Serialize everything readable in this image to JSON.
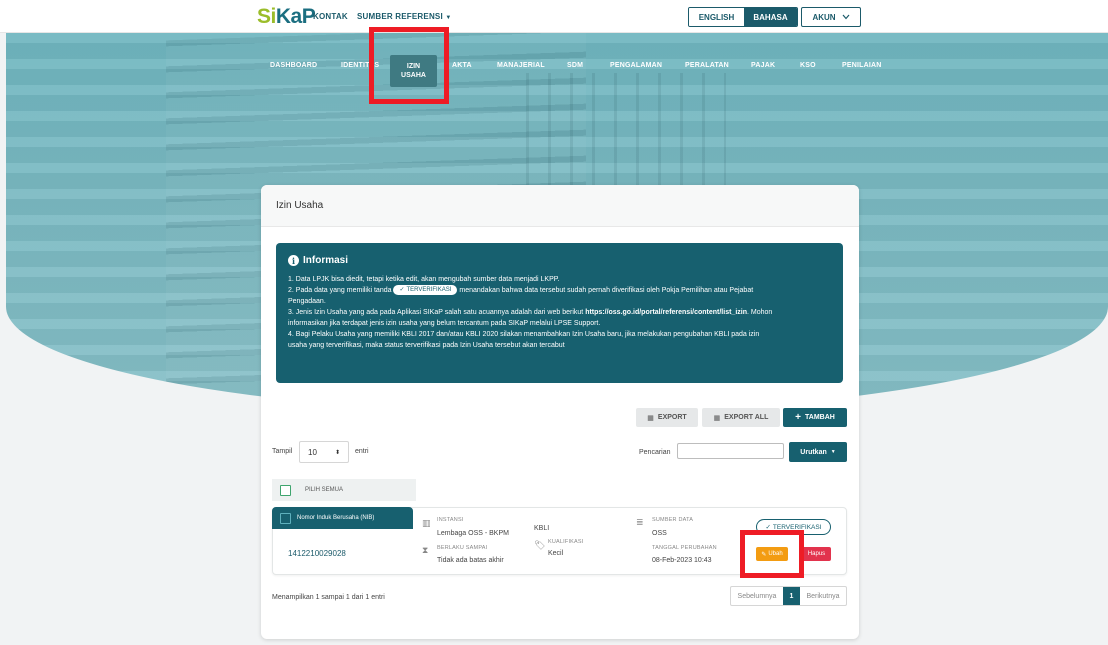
{
  "topbar": {
    "logo_part1": "Si",
    "logo_part2": "KaP",
    "links": [
      "KONTAK",
      "SUMBER REFERENSI"
    ],
    "dropdown_caret": "▼",
    "lang_en": "ENGLISH",
    "lang_id": "BAHASA",
    "akun": "AKUN"
  },
  "nav": {
    "items": [
      "DASHBOARD",
      "IDENTITAS",
      "AKTA",
      "MANAJERIAL",
      "SDM",
      "PENGALAMAN",
      "PERALATAN",
      "PAJAK",
      "KSO",
      "PENILAIAN"
    ],
    "active_line1": "IZIN",
    "active_line2": "USAHA"
  },
  "card": {
    "title": "Izin Usaha"
  },
  "info": {
    "title": "Informasi",
    "lines": [
      "1. Data LPJK bisa diedit, tetapi ketika edit, akan mengubah sumber data menjadi LKPP.",
      "2. Pada data yang memiliki tanda",
      "menandakan bahwa data tersebut sudah pernah diverifikasi oleh Pokja Pemilihan atau Pejabat",
      "Pengadaan.",
      "3. Jenis Izin Usaha yang ada pada Aplikasi SIKaP salah satu acuannya adalah dari web berikut",
      "https://oss.go.id/portal/referensi/content/list_izin",
      ". Mohon",
      "informasikan jika terdapat jenis izin usaha yang belum tercantum pada SIKaP melalui LPSE Support.",
      "4. Bagi Pelaku Usaha yang memiliki KBLI 2017 dan/atau KBLI 2020 silakan menambahkan Izin Usaha baru, jika melakukan pengubahan KBLI pada izin",
      "usaha yang terverifikasi, maka status terverifikasi pada Izin Usaha tersebut akan tercabut"
    ],
    "pill": "TERVERIFIKASI"
  },
  "actions": {
    "export": "EXPORT",
    "export_all": "EXPORT ALL",
    "tambah": "TAMBAH"
  },
  "table_controls": {
    "show_label": "Tampil",
    "show_value": "10",
    "entries_label": "entri",
    "search_label": "Pencarian",
    "search_value": "",
    "sort_button": "Urutkan",
    "select_all": "PILIH SEMUA"
  },
  "row": {
    "nib_header": "Nomor Induk Berusaha (NIB)",
    "nib": "1412210029028",
    "instansi_label": "INSTANSI",
    "instansi": "Lembaga OSS - BKPM",
    "berlaku_label": "BERLAKU SAMPAI",
    "berlaku": "Tidak ada batas akhir",
    "kbli": "KBLI",
    "kualifikasi_label": "KUALIFIKASI",
    "kualifikasi": "Kecil",
    "sumber_label": "SUMBER DATA",
    "sumber": "OSS",
    "tanggal_label": "TANGGAL PERUBAHAN",
    "tanggal": "08-Feb-2023 10:43",
    "status": "TERVERIFIKASI",
    "ubah": "Ubah",
    "hapus": "Hapus"
  },
  "footer": {
    "summary": "Menampilkan 1 sampai 1 dari 1 entri",
    "prev": "Sebelumnya",
    "page": "1",
    "next": "Berikutnya"
  },
  "colors": {
    "primary": "#17606f",
    "highlight": "#ee1c25",
    "warning": "#f39c12",
    "danger": "#e2334d"
  }
}
